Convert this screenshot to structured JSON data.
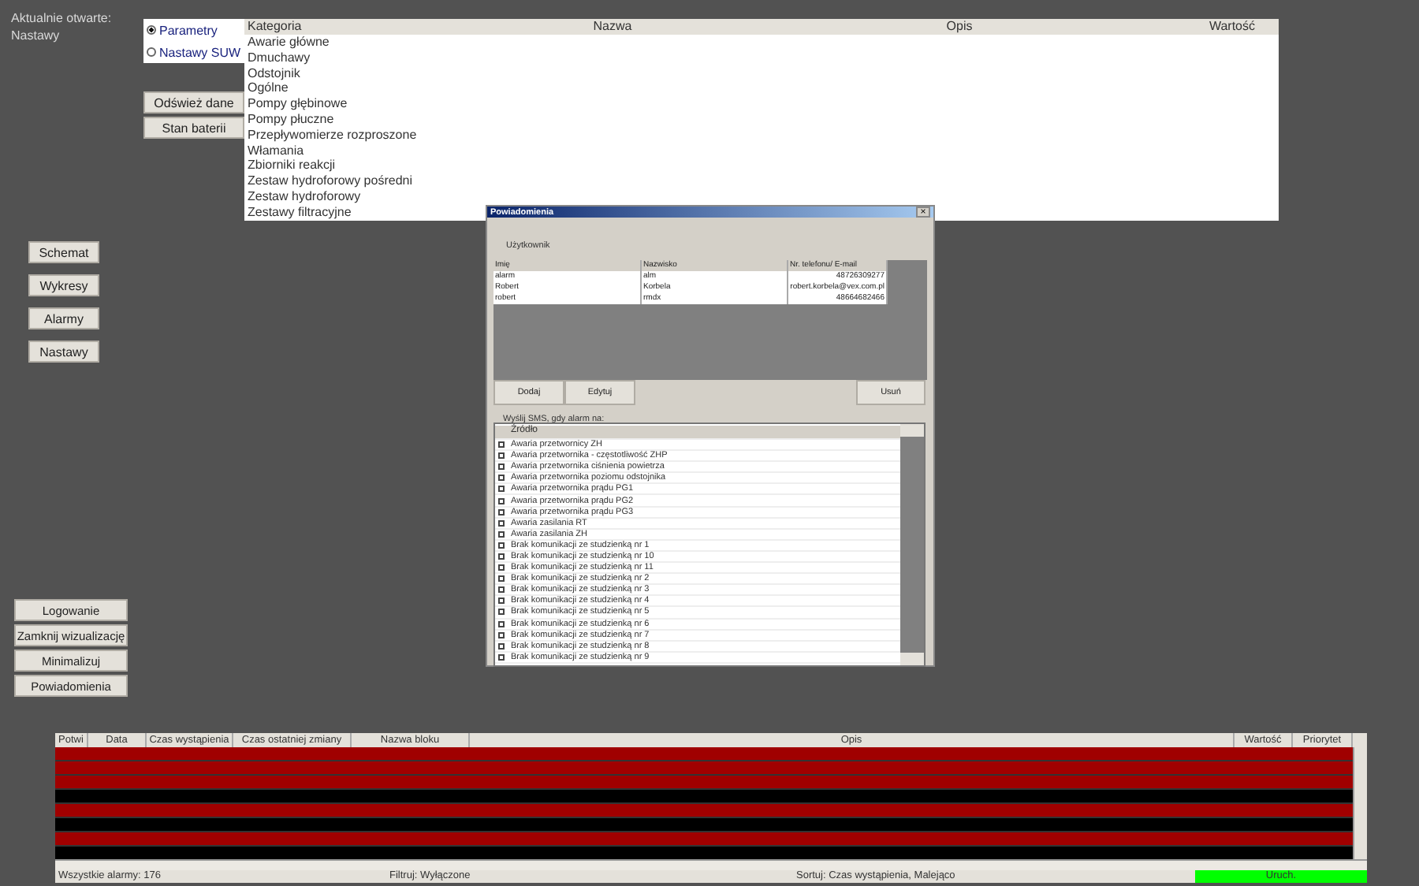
{
  "opened": {
    "label": "Aktualnie otwarte:",
    "value": "Nastawy"
  },
  "modes": [
    {
      "label": "Parametry",
      "selected": true
    },
    {
      "label": "Nastawy SUW",
      "selected": false
    }
  ],
  "actions": [
    "Odśwież dane",
    "Stan baterii"
  ],
  "params_table": {
    "columns": [
      "Kategoria",
      "Nazwa",
      "Opis",
      "Wartość"
    ],
    "rows": [
      "Awarie główne",
      "Dmuchawy",
      "Odstojnik",
      "Ogólne",
      "Pompy głębinowe",
      "Pompy płuczne",
      "Przepływomierze rozproszone",
      "Włamania",
      "Zbiorniki reakcji",
      "Zestaw hydroforowy pośredni",
      "Zestaw hydroforowy",
      "Zestawy filtracyjne"
    ]
  },
  "nav": [
    "Schemat",
    "Wykresy",
    "Alarmy",
    "Nastawy"
  ],
  "system": [
    "Logowanie",
    "Zamknij wizualizację",
    "Minimalizuj",
    "Powiadomienia"
  ],
  "dialog": {
    "title": "Powiadomienia",
    "close": "×",
    "users_label": "Użytkownik",
    "user_columns": [
      "Imię",
      "Nazwisko",
      "Nr. telefonu/ E-mail"
    ],
    "users": [
      [
        "alarm",
        "alm",
        "48726309277"
      ],
      [
        "Robert",
        "Korbela",
        "robert.korbela@vex.com.pl"
      ],
      [
        "robert",
        "rmdx",
        "48664682466"
      ]
    ],
    "buttons": [
      "Dodaj",
      "Edytuj",
      "Usuń"
    ],
    "sms_label": "Wyślij SMS, gdy alarm na:",
    "source_column": "Źródło",
    "sources": [
      {
        "label": "Awaria przetwornicy ZH",
        "checked": false
      },
      {
        "label": "Awaria przetwornika - częstotliwość ZHP",
        "checked": false
      },
      {
        "label": "Awaria przetwornika ciśnienia powietrza",
        "checked": false
      },
      {
        "label": "Awaria przetwornika poziomu odstojnika",
        "checked": false
      },
      {
        "label": "Awaria przetwornika prądu PG1",
        "checked": false
      },
      {
        "label": "Awaria przetwornika prądu PG2",
        "checked": false
      },
      {
        "label": "Awaria przetwornika prądu PG3",
        "checked": false
      },
      {
        "label": "Awaria zasilania RT",
        "checked": false
      },
      {
        "label": "Awaria zasilania ZH",
        "checked": false
      },
      {
        "label": "Brak komunikacji ze studzienką nr 1",
        "checked": false
      },
      {
        "label": "Brak komunikacji ze studzienką nr 10",
        "checked": false
      },
      {
        "label": "Brak komunikacji ze studzienką nr 11",
        "checked": false
      },
      {
        "label": "Brak komunikacji ze studzienką nr 2",
        "checked": false
      },
      {
        "label": "Brak komunikacji ze studzienką nr 3",
        "checked": false
      },
      {
        "label": "Brak komunikacji ze studzienką nr 4",
        "checked": false
      },
      {
        "label": "Brak komunikacji ze studzienką nr 5",
        "checked": false
      },
      {
        "label": "Brak komunikacji ze studzienką nr 6",
        "checked": false
      },
      {
        "label": "Brak komunikacji ze studzienką nr 7",
        "checked": false
      },
      {
        "label": "Brak komunikacji ze studzienką nr 8",
        "checked": false
      },
      {
        "label": "Brak komunikacji ze studzienką nr 9",
        "checked": false
      }
    ]
  },
  "alarms": {
    "columns": [
      "Potwi",
      "Data",
      "Czas wystąpienia",
      "Czas ostatniej zmiany",
      "Nazwa bloku",
      "Opis",
      "Wartość",
      "Priorytet"
    ],
    "rows": [
      {
        "kind": "critical"
      },
      {
        "kind": "critical"
      },
      {
        "kind": "critical"
      },
      {
        "kind": "info"
      },
      {
        "kind": "critical"
      },
      {
        "kind": "info"
      },
      {
        "kind": "critical"
      },
      {
        "kind": "info"
      }
    ]
  },
  "status_bar": {
    "total": "Wszystkie alarmy: 176",
    "filter": "Filtruj: Wyłączone",
    "sort": "Sortuj: Czas wystąpienia, Malejąco",
    "state": "Uruch."
  }
}
